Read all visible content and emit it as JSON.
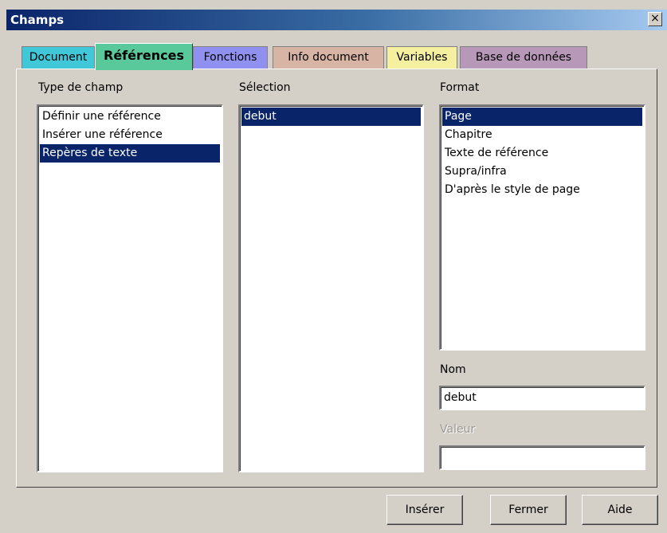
{
  "window": {
    "title": "Champs",
    "close_label": "×"
  },
  "tabs": [
    {
      "label": "Document",
      "color": "#40c8d8"
    },
    {
      "label": "Références",
      "color": "#59c89a",
      "active": true
    },
    {
      "label": "Fonctions",
      "color": "#9090f0"
    },
    {
      "label": "Info document",
      "color": "#d8b4a4"
    },
    {
      "label": "Variables",
      "color": "#f4f0a0"
    },
    {
      "label": "Base de données",
      "color": "#b898b8"
    }
  ],
  "field_type": {
    "label": "Type de champ",
    "items": [
      "Définir une référence",
      "Insérer une référence",
      "Repères de texte"
    ],
    "selected_index": 2
  },
  "selection": {
    "label": "Sélection",
    "items": [
      "debut"
    ],
    "selected_index": 0
  },
  "format": {
    "label": "Format",
    "items": [
      "Page",
      "Chapitre",
      "Texte de référence",
      "Supra/infra",
      "D'après le style de page"
    ],
    "selected_index": 0
  },
  "name": {
    "label": "Nom",
    "value": "debut"
  },
  "value": {
    "label": "Valeur",
    "value": ""
  },
  "buttons": {
    "insert": "Insérer",
    "close": "Fermer",
    "help": "Aide"
  },
  "colors": {
    "selection": "#0a246a",
    "dialog": "#d4d0c8"
  }
}
